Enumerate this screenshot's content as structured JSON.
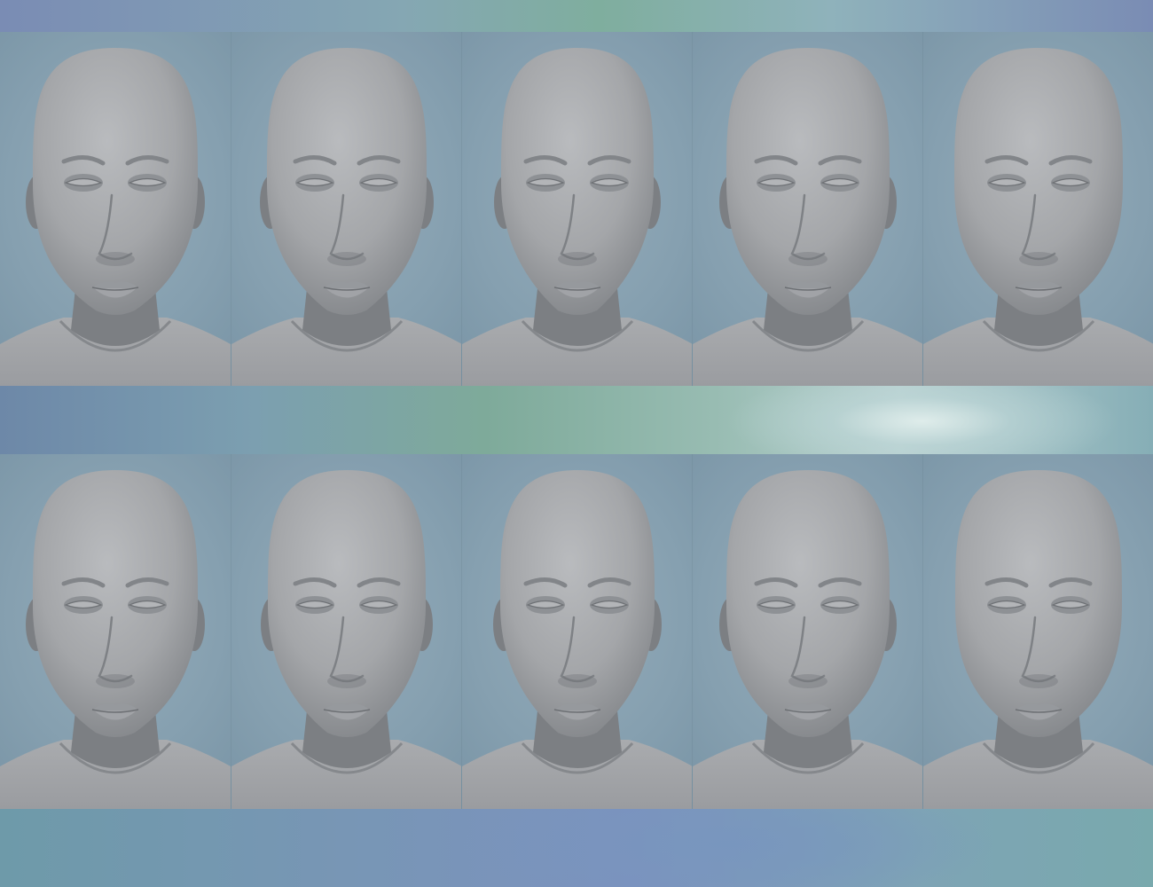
{
  "image": {
    "rows": 2,
    "columns": 5,
    "subject": "grey-clay-head-render",
    "colors": {
      "tile_background": "#88a2b2",
      "skin": "#a4a6a9",
      "shadow": "#7c7f83",
      "band_green": "#7faa9c",
      "band_blue": "#7b8fbf",
      "band_light": "#dde9e8"
    },
    "faces": [
      {
        "row": 1,
        "col": 1,
        "width": 0.93,
        "jaw": 0.8,
        "ears": true
      },
      {
        "row": 1,
        "col": 2,
        "width": 0.9,
        "jaw": 0.76,
        "ears": true
      },
      {
        "row": 1,
        "col": 3,
        "width": 0.86,
        "jaw": 0.72,
        "ears": true
      },
      {
        "row": 1,
        "col": 4,
        "width": 0.92,
        "jaw": 0.8,
        "ears": true
      },
      {
        "row": 1,
        "col": 5,
        "width": 0.95,
        "jaw": 0.84,
        "ears": false
      },
      {
        "row": 2,
        "col": 1,
        "width": 0.93,
        "jaw": 0.78,
        "ears": true
      },
      {
        "row": 2,
        "col": 2,
        "width": 0.89,
        "jaw": 0.74,
        "ears": true
      },
      {
        "row": 2,
        "col": 3,
        "width": 0.87,
        "jaw": 0.72,
        "ears": true
      },
      {
        "row": 2,
        "col": 4,
        "width": 0.92,
        "jaw": 0.8,
        "ears": true
      },
      {
        "row": 2,
        "col": 5,
        "width": 0.94,
        "jaw": 0.82,
        "ears": false
      }
    ]
  }
}
